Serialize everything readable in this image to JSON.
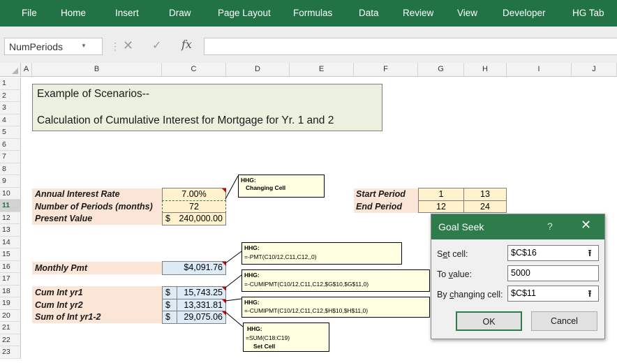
{
  "ribbon": {
    "tabs": [
      "File",
      "Home",
      "Insert",
      "Draw",
      "Page Layout",
      "Formulas",
      "Data",
      "Review",
      "View",
      "Developer",
      "HG Tab"
    ]
  },
  "formula_bar": {
    "name_box": "NumPeriods",
    "fx": "fx",
    "formula": ""
  },
  "grid": {
    "columns": [
      "A",
      "B",
      "C",
      "D",
      "E",
      "F",
      "G",
      "H",
      "I",
      "J"
    ],
    "rows": [
      "1",
      "2",
      "3",
      "4",
      "5",
      "6",
      "7",
      "8",
      "9",
      "10",
      "11",
      "12",
      "13",
      "14",
      "15",
      "16",
      "17",
      "18",
      "19",
      "20",
      "21",
      "22",
      "23"
    ]
  },
  "sheet": {
    "title_line1": "Example of Scenarios--",
    "title_line2": "Calculation of Cumulative Interest for Mortgage for Yr. 1 and 2",
    "annual_rate_label": "Annual Interest Rate",
    "annual_rate_value": "7.00%",
    "periods_label": "Number of Periods (months)",
    "periods_value": "72",
    "pv_label": "Present Value",
    "pv_dollar": "$",
    "pv_value": "240,000.00",
    "monthly_pmt_label": "Monthly Pmt",
    "monthly_pmt_value": "$4,091.76",
    "cum_yr1_label": "Cum Int yr1",
    "cum_yr1_dollar": "$",
    "cum_yr1_value": "15,743.25",
    "cum_yr2_label": "Cum Int yr2",
    "cum_yr2_dollar": "$",
    "cum_yr2_value": "13,331.81",
    "sum_label": "Sum of Int yr1-2",
    "sum_dollar": "$",
    "sum_value": "29,075.06",
    "start_period_label": "Start Period",
    "start_g": "1",
    "start_h": "13",
    "end_period_label": "End Period",
    "end_g": "12",
    "end_h": "24"
  },
  "notes": {
    "changing_cell_author": "HHG:",
    "changing_cell_text": "Changing Cell",
    "pmt_author": "HHG:",
    "pmt_text": "=-PMT(C10/12,C11,C12,,0)",
    "cum1_author": "HHG:",
    "cum1_text": "=-CUMIPMT(C10/12,C11,C12,$G$10,$G$11,0)",
    "cum2_author": "HHG:",
    "cum2_text": "=-CUMIPMT(C10/12,C11,C12,$H$10,$H$11,0)",
    "sum_author": "HHG:",
    "sum_text": "=SUM(C18:C19)",
    "sum_text2": "Set Cell"
  },
  "goal_seek": {
    "title": "Goal Seek",
    "help": "?",
    "close": "✕",
    "set_cell_pre": "S",
    "set_cell_ul": "e",
    "set_cell_post": "t cell:",
    "set_cell_value": "$C$16",
    "to_value_pre": "To ",
    "to_value_ul": "v",
    "to_value_post": "alue:",
    "to_value_value": "5000",
    "changing_pre": "By ",
    "changing_ul": "c",
    "changing_post": "hanging cell:",
    "changing_value": "$C$11",
    "ok": "OK",
    "cancel": "Cancel",
    "ref_icon": "⭱"
  },
  "colors": {
    "ribbon": "#217346",
    "dialog_title": "#2e7b4b",
    "input_cell": "#fff2cc",
    "label_bg": "#fbe5d6",
    "result_bg": "#ddebf7",
    "title_bg": "#ebf1de",
    "note_bg": "#ffffe1"
  }
}
